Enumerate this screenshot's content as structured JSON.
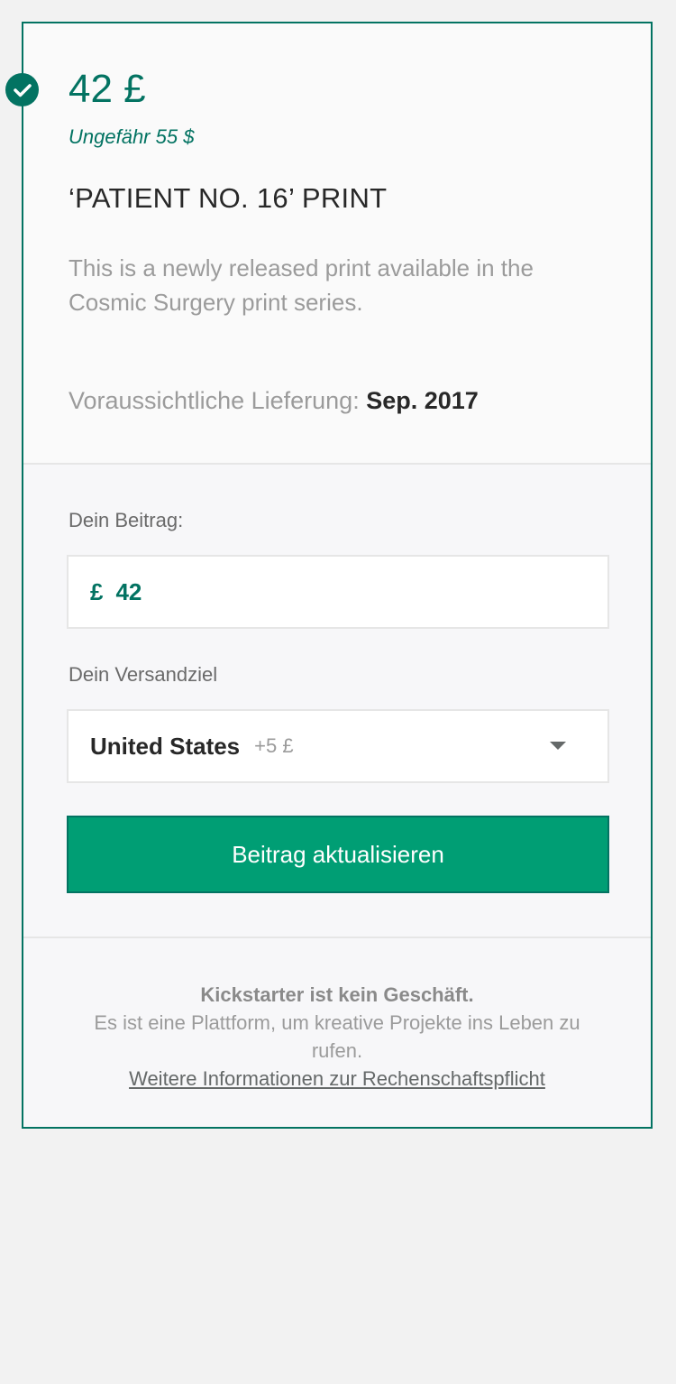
{
  "reward": {
    "price": "42 £",
    "approx": "Ungefähr 55 $",
    "title": "‘PATIENT NO. 16’ PRINT",
    "description": "This is a newly released print available in the Cosmic Surgery print series.",
    "delivery_label": "Voraussichtliche Lieferung:",
    "delivery_value": "Sep. 2017"
  },
  "pledge": {
    "label": "Dein Beitrag:",
    "currency": "£",
    "amount": "42"
  },
  "shipping": {
    "label": "Dein Versandziel",
    "country": "United States",
    "extra": "+5 £"
  },
  "button": {
    "label": "Beitrag aktualisieren"
  },
  "footer": {
    "line1": "Kickstarter ist kein Geschäft.",
    "line2": "Es ist eine Plattform, um kreative Projekte ins Leben zu rufen.",
    "link": "Weitere Informationen zur Rechenschaftspflicht"
  },
  "colors": {
    "accent": "#037362",
    "button": "#009e74"
  },
  "icons": {
    "selected": "checkmark-icon",
    "dropdown": "chevron-down-icon"
  }
}
